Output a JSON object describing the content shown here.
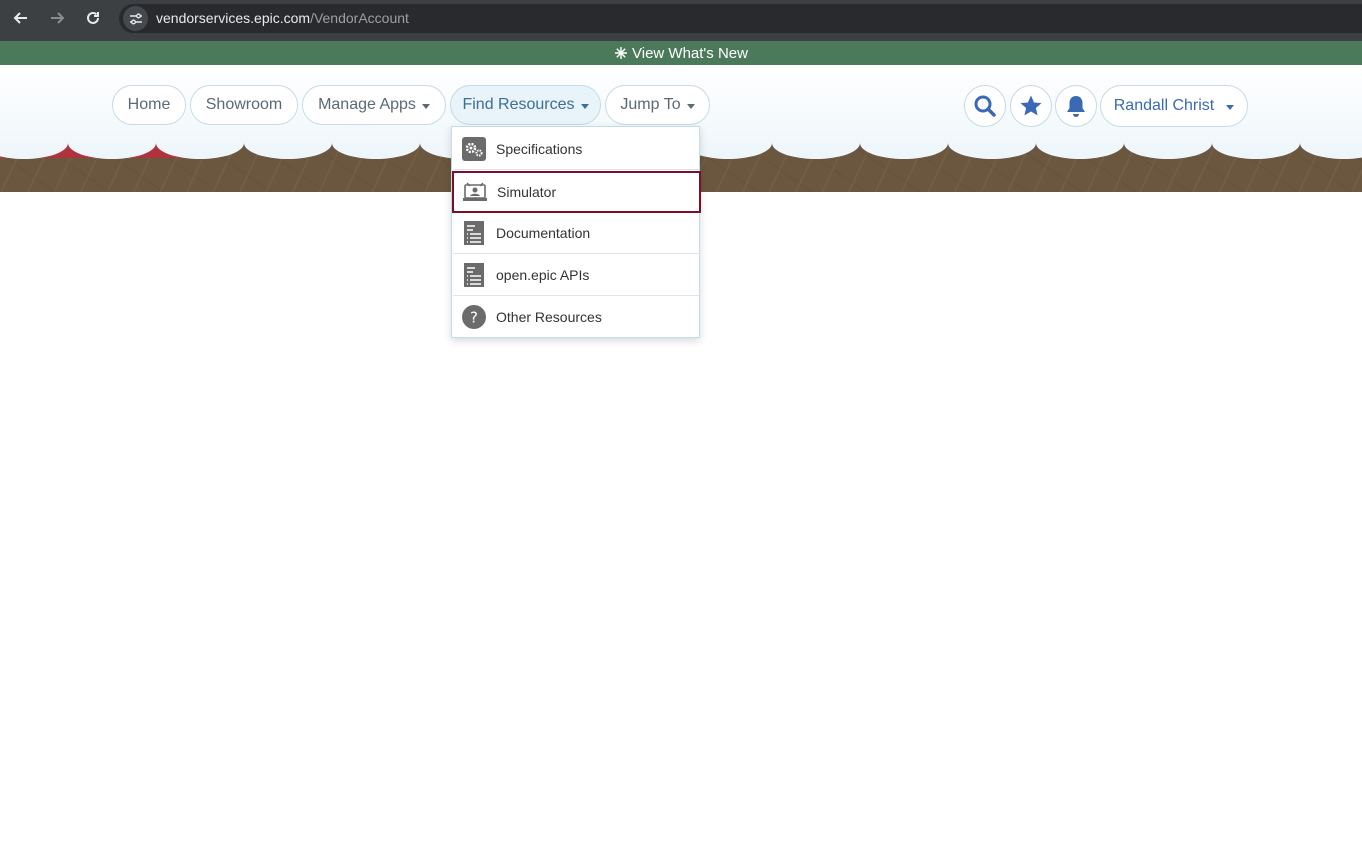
{
  "browser": {
    "url_domain": "vendorservices.epic.com",
    "url_path": "/VendorAccount"
  },
  "banner": {
    "label": "View What's New"
  },
  "nav": {
    "home": "Home",
    "showroom": "Showroom",
    "manage_apps": "Manage Apps",
    "find_resources": "Find Resources",
    "jump_to": "Jump To",
    "user_name": "Randall Christ"
  },
  "dropdown": {
    "items": [
      {
        "label": "Specifications",
        "icon": "gears-icon"
      },
      {
        "label": "Simulator",
        "icon": "simulator-icon",
        "selected": true
      },
      {
        "label": "Documentation",
        "icon": "document-icon"
      },
      {
        "label": "open.epic APIs",
        "icon": "document-icon"
      },
      {
        "label": "Other Resources",
        "icon": "question-icon"
      }
    ]
  },
  "colors": {
    "banner": "#4b7a5b",
    "accent": "#3b6ab5",
    "selected_border": "#7a0f2a"
  }
}
